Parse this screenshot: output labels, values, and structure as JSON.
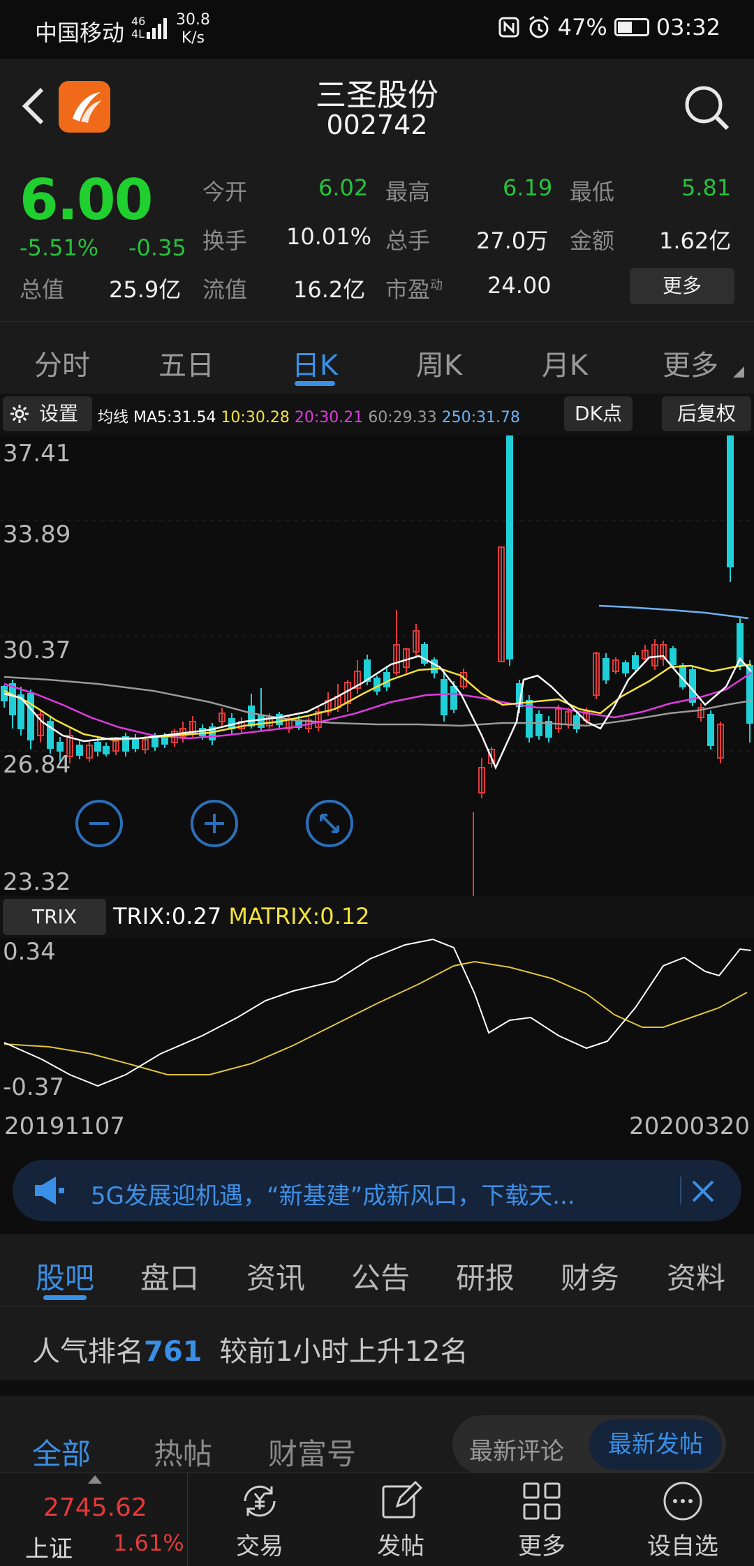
{
  "status_bar": {
    "carrier": "中国移动",
    "net_type_top": "46",
    "net_type_bottom": "4L",
    "speed_top": "30.8",
    "speed_bottom": "K/s",
    "battery": "47%",
    "time": "03:32"
  },
  "header": {
    "title": "三圣股份",
    "code": "002742"
  },
  "quote": {
    "price": "6.00",
    "change_pct": "-5.51%",
    "change": "-0.35",
    "cells": [
      {
        "label": "今开",
        "value": "6.02"
      },
      {
        "label": "最高",
        "value": "6.19"
      },
      {
        "label": "最低",
        "value": "5.81"
      },
      {
        "label": "换手",
        "value": "10.01%"
      },
      {
        "label": "总手",
        "value": "27.0万"
      },
      {
        "label": "金额",
        "value": "1.62亿"
      },
      {
        "label": "总值",
        "value": "25.9亿"
      },
      {
        "label": "流值",
        "value": "16.2亿"
      },
      {
        "label": "市盈",
        "label_sup": "动",
        "value": "24.00"
      }
    ],
    "more": "更多"
  },
  "periods": {
    "tabs": [
      "分时",
      "五日",
      "日K",
      "周K",
      "月K",
      "更多"
    ],
    "active": "日K"
  },
  "ma_bar": {
    "settings": "设置",
    "ma_label": "均线",
    "ma5": "MA5:31.54",
    "ma10": "10:30.28",
    "ma20": "20:30.21",
    "ma60": "60:29.33",
    "ma250": "250:31.78",
    "dk": "DK点",
    "adjust": "后复权"
  },
  "kchart": {
    "y_labels": [
      "37.41",
      "33.89",
      "30.37",
      "26.84",
      "23.32"
    ]
  },
  "trix": {
    "button": "TRIX",
    "trix_value": "TRIX:0.27",
    "matrix_value": "MATRIX:0.12",
    "y_labels": [
      "0.34",
      "-0.37"
    ]
  },
  "dates": {
    "start": "20191107",
    "end": "20200320"
  },
  "banner": {
    "text": "5G发展迎机遇，“新基建”成新风口，下载天..."
  },
  "sections": {
    "tabs": [
      "股吧",
      "盘口",
      "资讯",
      "公告",
      "研报",
      "财务",
      "资料"
    ],
    "active": "股吧"
  },
  "rank": {
    "prefix": "人气排名",
    "rank": "761",
    "suffix": "较前1小时上升12名"
  },
  "forum_tabs": {
    "tabs": [
      "全部",
      "热帖",
      "财富号"
    ],
    "sort_latest_comment": "最新评论",
    "sort_latest_post": "最新发帖"
  },
  "bottom": {
    "index_value": "2745.62",
    "index_name": "上证",
    "index_pct": "1.61%",
    "nav": [
      "交易",
      "发帖",
      "更多",
      "设自选"
    ]
  },
  "colors": {
    "up": "#e23a3a",
    "down": "#1fd0d8",
    "accent": "#3a8fe6",
    "ma5": "#ffffff",
    "ma10": "#f5e23a",
    "ma20": "#e03ae0",
    "ma60": "#9a9a9a",
    "ma250": "#6fb2f5"
  }
}
